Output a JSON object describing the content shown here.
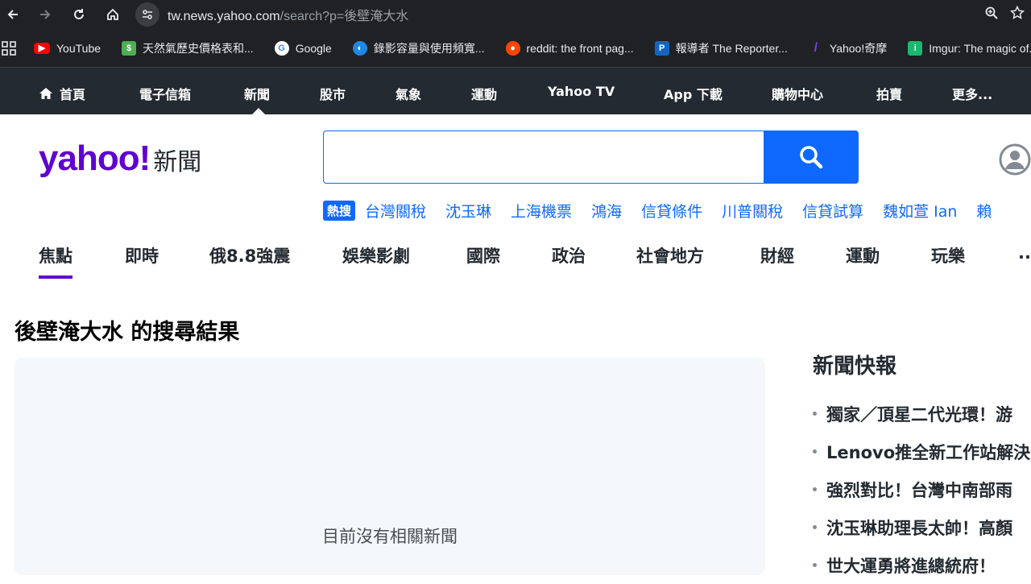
{
  "browser": {
    "url_host": "tw.news.yahoo.com",
    "url_rest": "/search?p=後壁淹大水"
  },
  "bookmarks": [
    {
      "label": "YouTube",
      "icon": "youtube-icon",
      "color": "#ff0000"
    },
    {
      "label": "天然氣歷史價格表和...",
      "icon": "gas-price-icon",
      "color": "#4caf50"
    },
    {
      "label": "Google",
      "icon": "google-icon",
      "color": "#4285f4"
    },
    {
      "label": "錄影容量與使用頻寬...",
      "icon": "camera-icon",
      "color": "#1e88e5"
    },
    {
      "label": "reddit: the front pag...",
      "icon": "reddit-icon",
      "color": "#ff4500"
    },
    {
      "label": "報導者 The Reporter...",
      "icon": "reporter-icon",
      "color": "#1565c0"
    },
    {
      "label": "Yahoo!奇摩",
      "icon": "yahoo-icon",
      "color": "#6001d2"
    },
    {
      "label": "Imgur: The magic of...",
      "icon": "imgur-icon",
      "color": "#1bb76e"
    }
  ],
  "yahoo_nav": [
    {
      "label": "首頁"
    },
    {
      "label": "電子信箱"
    },
    {
      "label": "新聞"
    },
    {
      "label": "股市"
    },
    {
      "label": "氣象"
    },
    {
      "label": "運動"
    },
    {
      "label": "Yahoo TV"
    },
    {
      "label": "App 下載"
    },
    {
      "label": "購物中心"
    },
    {
      "label": "拍賣"
    },
    {
      "label": "更多..."
    }
  ],
  "logo": {
    "brand": "yahoo!",
    "section": "新聞"
  },
  "search": {
    "value": "",
    "placeholder": ""
  },
  "trending": {
    "badge": "熱搜",
    "items": [
      "台灣關稅",
      "沈玉琳",
      "上海機票",
      "鴻海",
      "信貸條件",
      "川普關稅",
      "信貸試算",
      "魏如萱 Ian",
      "賴"
    ]
  },
  "categories": [
    "焦點",
    "即時",
    "俄8.8強震",
    "娛樂影劇",
    "國際",
    "政治",
    "社會地方",
    "財經",
    "運動",
    "玩樂",
    "..."
  ],
  "main": {
    "results_title": "後壁淹大水 的搜尋結果",
    "empty_text": "目前沒有相關新聞"
  },
  "sidebar": {
    "title": "新聞快報",
    "items": [
      "獨家／頂星二代光環！游",
      "Lenovo推全新工作站解決",
      "強烈對比！台灣中南部雨",
      "沈玉琳助理長太帥！高顏",
      "世大運勇將進總統府！"
    ]
  },
  "colors": {
    "brand": "#6001d2",
    "accent": "#0f69ff",
    "nav_bg": "#232a31"
  }
}
